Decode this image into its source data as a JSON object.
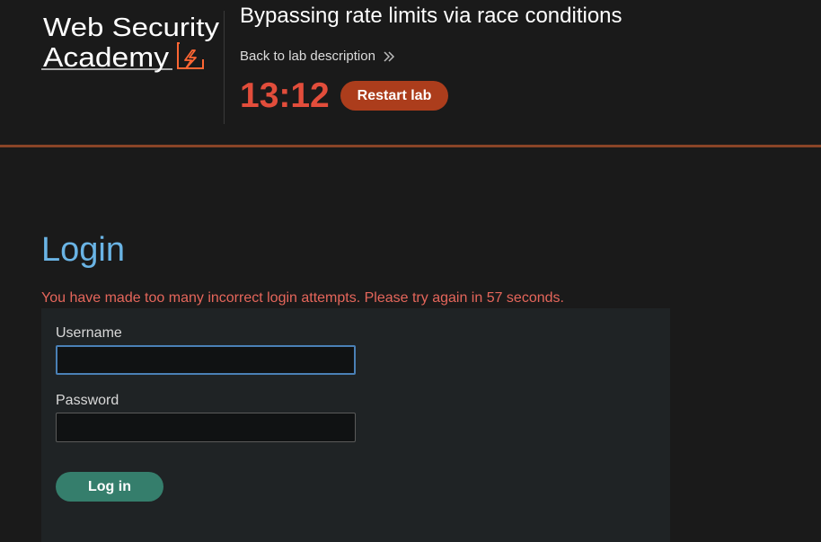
{
  "header": {
    "logo_line1": "Web Security",
    "logo_line2": "Academy",
    "lab_title": "Bypassing rate limits via race conditions",
    "back_link": "Back to lab description",
    "timer": "13:12",
    "restart_label": "Restart lab"
  },
  "main": {
    "page_title": "Login",
    "error_message": "You have made too many incorrect login attempts. Please try again in 57 seconds.",
    "form": {
      "username_label": "Username",
      "username_value": "",
      "password_label": "Password",
      "password_value": "",
      "submit_label": "Log in"
    }
  },
  "colors": {
    "timer": "#e24d3b",
    "restart_button": "#ac3d1c",
    "accent_line": "#8a4427",
    "title": "#6ab4e5",
    "error": "#e5665b",
    "login_button": "#357e6c"
  },
  "icons": {
    "back_link": "double-chevron-right-icon",
    "logo": "lightning-bolt-icon"
  }
}
